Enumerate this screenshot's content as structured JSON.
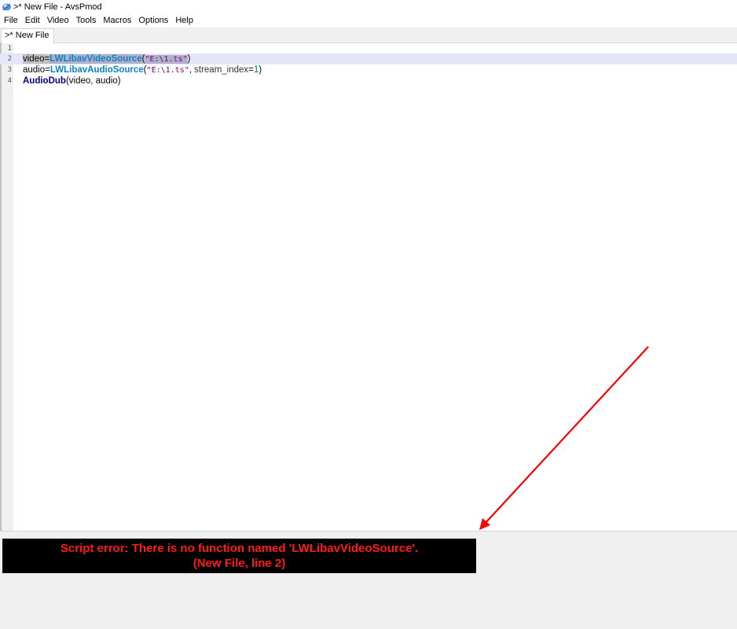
{
  "window": {
    "title": ">* New File - AvsPmod"
  },
  "menu": {
    "items": [
      "File",
      "Edit",
      "Video",
      "Tools",
      "Macros",
      "Options",
      "Help"
    ]
  },
  "tabs": [
    {
      "label": ">* New File"
    }
  ],
  "editor": {
    "line_numbers": [
      "1",
      "2",
      "3",
      "4"
    ],
    "lines": {
      "l2": {
        "var": "video",
        "eq": "=",
        "func": "LWLibavVideoSource",
        "open": "(",
        "str": "\"E:\\1.ts\"",
        "close": ")"
      },
      "l3": {
        "var": "audio",
        "eq": "=",
        "func": "LWLibavAudioSource",
        "open": "(",
        "str": "\"E:\\1.ts\"",
        "sep": ", ",
        "param": "stream_index",
        "eq2": "=",
        "num": "1",
        "close": ")"
      },
      "l4": {
        "func": "AudioDub",
        "args": "(video, audio)"
      }
    }
  },
  "preview": {
    "error_line1": "Script error: There is no function named 'LWLibavVideoSource'.",
    "error_line2": "(New File, line 2)",
    "error_color": "#ff1a1a",
    "error_bg": "#000000"
  },
  "annotation": {
    "arrow_color": "#ff0000"
  }
}
